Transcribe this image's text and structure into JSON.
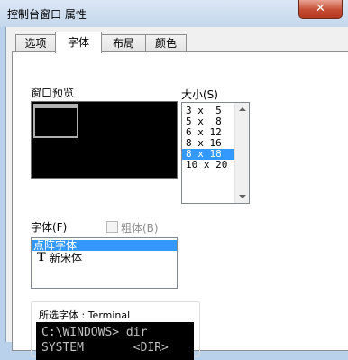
{
  "window": {
    "title": "控制台窗口 属性",
    "close": "✕"
  },
  "tabs": [
    "选项",
    "字体",
    "布局",
    "颜色"
  ],
  "preview": {
    "label": "窗口预览"
  },
  "size": {
    "label": "大小(S)",
    "items": [
      "3 x  5",
      "5 x  8",
      "6 x 12",
      "8 x 16",
      "8 x 18",
      "10 x 20"
    ],
    "selected_index": 4
  },
  "font": {
    "label": "字体(F)",
    "bold_label": "粗体(B)",
    "bold_checked": false,
    "items": [
      "点阵字体",
      "新宋体"
    ],
    "selected_index": 0,
    "truetype_icon": "T"
  },
  "selected_font": {
    "label": "所选字体 : Terminal",
    "sample_lines": [
      "C:\\WINDOWS> dir",
      "SYSTEM       <DIR>"
    ]
  },
  "colors": {
    "selection": "#3399ff",
    "terminal_bg": "#000000",
    "close_red": "#c44c33"
  }
}
